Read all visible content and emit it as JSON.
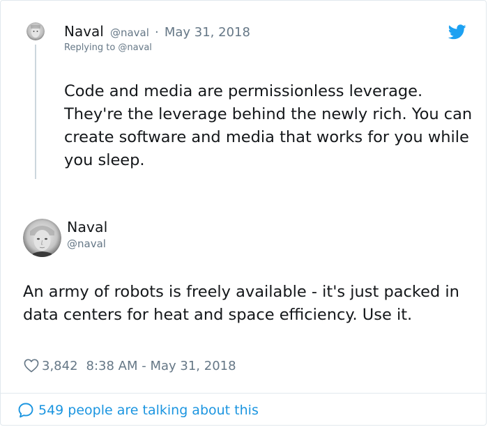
{
  "reply_tweet": {
    "author_name": "Naval",
    "author_handle": "@naval",
    "separator": "·",
    "date": "May 31, 2018",
    "replying_to": "Replying to @naval",
    "text": "Code and media are permissionless leverage. They're the leverage behind the newly rich. You can create software and media that works for you while you sleep."
  },
  "main_tweet": {
    "author_name": "Naval",
    "author_handle": "@naval",
    "text": "An army of robots is freely available - it's just packed in data centers for heat and space efficiency. Use it.",
    "like_count": "3,842",
    "timestamp": "8:38 AM - May 31, 2018"
  },
  "footer": {
    "talking_text": "549 people are talking about this"
  },
  "icons": {
    "brand": "twitter-bird-icon",
    "like": "heart-icon",
    "conversation": "speech-bubble-icon"
  },
  "colors": {
    "accent": "#1da1f2",
    "link": "#1b95e0",
    "muted": "#657786",
    "text": "#14171a"
  }
}
